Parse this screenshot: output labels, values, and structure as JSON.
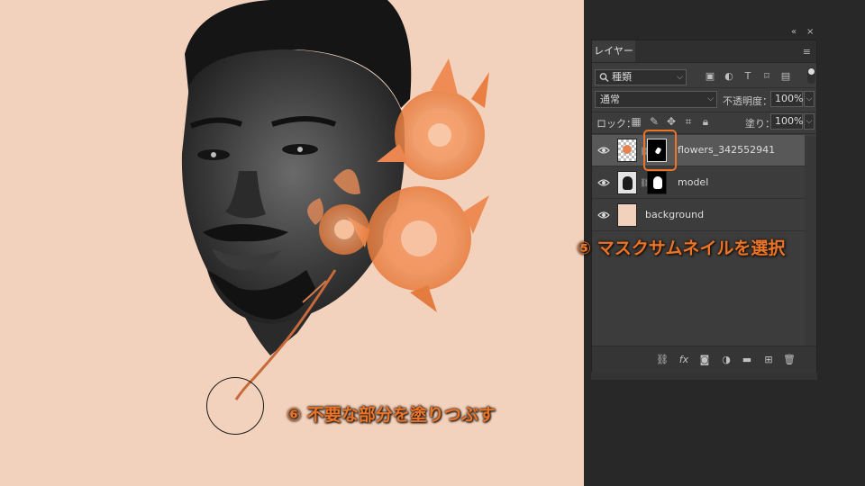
{
  "annotations": {
    "step5": "⑤ マスクサムネイルを選択",
    "step6": "⑥ 不要な部分を塗りつぶす"
  },
  "panel": {
    "tab": "レイヤー",
    "menu_icon": "hamburger-icon",
    "filter": {
      "value": "種類",
      "icon": "search-icon"
    },
    "blend_mode": "通常",
    "opacity_label": "不透明度：",
    "opacity_value": "100%",
    "lock_label": "ロック：",
    "fill_label": "塗り：",
    "fill_value": "100%",
    "layers": [
      {
        "name": "flowers_342552941",
        "selected": true,
        "visible": true
      },
      {
        "name": "model",
        "selected": false,
        "visible": true
      },
      {
        "name": "background",
        "selected": false,
        "visible": true
      }
    ]
  },
  "dock_controls": {
    "collapse": "«",
    "close": "×"
  },
  "colors": {
    "canvas_bg": "#f3d2bd",
    "accent": "#ea7428",
    "panel_bg": "#3c3c3c",
    "selected_row": "#585858"
  }
}
